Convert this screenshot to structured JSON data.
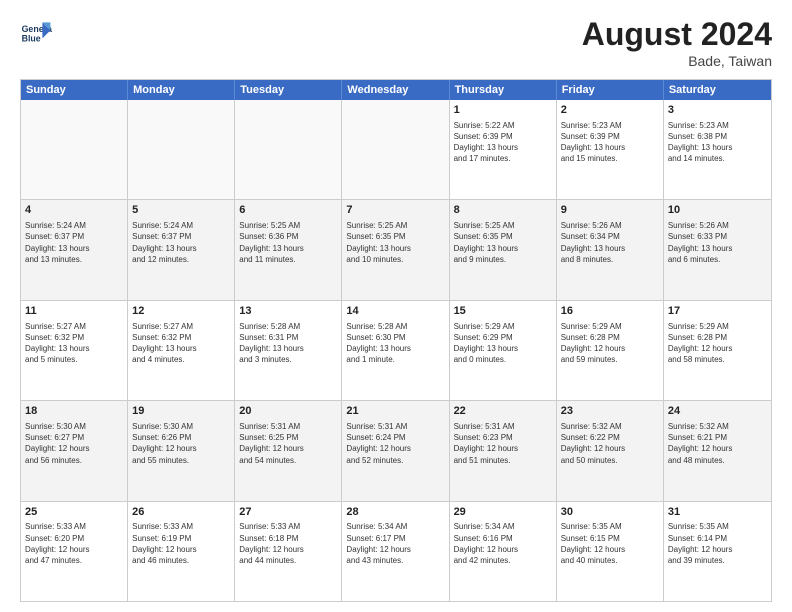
{
  "header": {
    "logo_line1": "General",
    "logo_line2": "Blue",
    "month_year": "August 2024",
    "location": "Bade, Taiwan"
  },
  "days_of_week": [
    "Sunday",
    "Monday",
    "Tuesday",
    "Wednesday",
    "Thursday",
    "Friday",
    "Saturday"
  ],
  "rows": [
    [
      {
        "day": "",
        "info": ""
      },
      {
        "day": "",
        "info": ""
      },
      {
        "day": "",
        "info": ""
      },
      {
        "day": "",
        "info": ""
      },
      {
        "day": "1",
        "info": "Sunrise: 5:22 AM\nSunset: 6:39 PM\nDaylight: 13 hours\nand 17 minutes."
      },
      {
        "day": "2",
        "info": "Sunrise: 5:23 AM\nSunset: 6:39 PM\nDaylight: 13 hours\nand 15 minutes."
      },
      {
        "day": "3",
        "info": "Sunrise: 5:23 AM\nSunset: 6:38 PM\nDaylight: 13 hours\nand 14 minutes."
      }
    ],
    [
      {
        "day": "4",
        "info": "Sunrise: 5:24 AM\nSunset: 6:37 PM\nDaylight: 13 hours\nand 13 minutes."
      },
      {
        "day": "5",
        "info": "Sunrise: 5:24 AM\nSunset: 6:37 PM\nDaylight: 13 hours\nand 12 minutes."
      },
      {
        "day": "6",
        "info": "Sunrise: 5:25 AM\nSunset: 6:36 PM\nDaylight: 13 hours\nand 11 minutes."
      },
      {
        "day": "7",
        "info": "Sunrise: 5:25 AM\nSunset: 6:35 PM\nDaylight: 13 hours\nand 10 minutes."
      },
      {
        "day": "8",
        "info": "Sunrise: 5:25 AM\nSunset: 6:35 PM\nDaylight: 13 hours\nand 9 minutes."
      },
      {
        "day": "9",
        "info": "Sunrise: 5:26 AM\nSunset: 6:34 PM\nDaylight: 13 hours\nand 8 minutes."
      },
      {
        "day": "10",
        "info": "Sunrise: 5:26 AM\nSunset: 6:33 PM\nDaylight: 13 hours\nand 6 minutes."
      }
    ],
    [
      {
        "day": "11",
        "info": "Sunrise: 5:27 AM\nSunset: 6:32 PM\nDaylight: 13 hours\nand 5 minutes."
      },
      {
        "day": "12",
        "info": "Sunrise: 5:27 AM\nSunset: 6:32 PM\nDaylight: 13 hours\nand 4 minutes."
      },
      {
        "day": "13",
        "info": "Sunrise: 5:28 AM\nSunset: 6:31 PM\nDaylight: 13 hours\nand 3 minutes."
      },
      {
        "day": "14",
        "info": "Sunrise: 5:28 AM\nSunset: 6:30 PM\nDaylight: 13 hours\nand 1 minute."
      },
      {
        "day": "15",
        "info": "Sunrise: 5:29 AM\nSunset: 6:29 PM\nDaylight: 13 hours\nand 0 minutes."
      },
      {
        "day": "16",
        "info": "Sunrise: 5:29 AM\nSunset: 6:28 PM\nDaylight: 12 hours\nand 59 minutes."
      },
      {
        "day": "17",
        "info": "Sunrise: 5:29 AM\nSunset: 6:28 PM\nDaylight: 12 hours\nand 58 minutes."
      }
    ],
    [
      {
        "day": "18",
        "info": "Sunrise: 5:30 AM\nSunset: 6:27 PM\nDaylight: 12 hours\nand 56 minutes."
      },
      {
        "day": "19",
        "info": "Sunrise: 5:30 AM\nSunset: 6:26 PM\nDaylight: 12 hours\nand 55 minutes."
      },
      {
        "day": "20",
        "info": "Sunrise: 5:31 AM\nSunset: 6:25 PM\nDaylight: 12 hours\nand 54 minutes."
      },
      {
        "day": "21",
        "info": "Sunrise: 5:31 AM\nSunset: 6:24 PM\nDaylight: 12 hours\nand 52 minutes."
      },
      {
        "day": "22",
        "info": "Sunrise: 5:31 AM\nSunset: 6:23 PM\nDaylight: 12 hours\nand 51 minutes."
      },
      {
        "day": "23",
        "info": "Sunrise: 5:32 AM\nSunset: 6:22 PM\nDaylight: 12 hours\nand 50 minutes."
      },
      {
        "day": "24",
        "info": "Sunrise: 5:32 AM\nSunset: 6:21 PM\nDaylight: 12 hours\nand 48 minutes."
      }
    ],
    [
      {
        "day": "25",
        "info": "Sunrise: 5:33 AM\nSunset: 6:20 PM\nDaylight: 12 hours\nand 47 minutes."
      },
      {
        "day": "26",
        "info": "Sunrise: 5:33 AM\nSunset: 6:19 PM\nDaylight: 12 hours\nand 46 minutes."
      },
      {
        "day": "27",
        "info": "Sunrise: 5:33 AM\nSunset: 6:18 PM\nDaylight: 12 hours\nand 44 minutes."
      },
      {
        "day": "28",
        "info": "Sunrise: 5:34 AM\nSunset: 6:17 PM\nDaylight: 12 hours\nand 43 minutes."
      },
      {
        "day": "29",
        "info": "Sunrise: 5:34 AM\nSunset: 6:16 PM\nDaylight: 12 hours\nand 42 minutes."
      },
      {
        "day": "30",
        "info": "Sunrise: 5:35 AM\nSunset: 6:15 PM\nDaylight: 12 hours\nand 40 minutes."
      },
      {
        "day": "31",
        "info": "Sunrise: 5:35 AM\nSunset: 6:14 PM\nDaylight: 12 hours\nand 39 minutes."
      }
    ]
  ]
}
